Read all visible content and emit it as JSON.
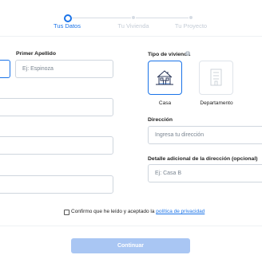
{
  "stepper": {
    "steps": [
      {
        "label": "Tus Datos",
        "state": "active"
      },
      {
        "label": "Tu Vivienda",
        "state": "inactive"
      },
      {
        "label": "Tu Proyecto",
        "state": "inactive"
      }
    ]
  },
  "form": {
    "apellido": {
      "label": "Primer Apellido",
      "placeholder": "Ej: Espinoza"
    },
    "tipo_vivienda": {
      "label": "Tipo de vivienda",
      "info_icon": "info-icon",
      "options": [
        {
          "label": "Casa",
          "icon": "house-icon",
          "selected": true
        },
        {
          "label": "Departamento",
          "icon": "building-icon",
          "selected": false
        }
      ]
    },
    "direccion": {
      "label": "Dirección",
      "placeholder": "Ingresa tu dirección"
    },
    "detalle": {
      "label": "Detalle adicional de la dirección (opcional)",
      "placeholder": "Ej: Casa B"
    }
  },
  "consent": {
    "text": "Confirmo que he leído y aceptado la ",
    "link_text": "política de privacidad"
  },
  "actions": {
    "continue_label": "Continuar"
  },
  "colors": {
    "accent": "#1a73e8",
    "disabled_button": "#a9c6f3",
    "inactive_step": "#c4ccd6"
  }
}
